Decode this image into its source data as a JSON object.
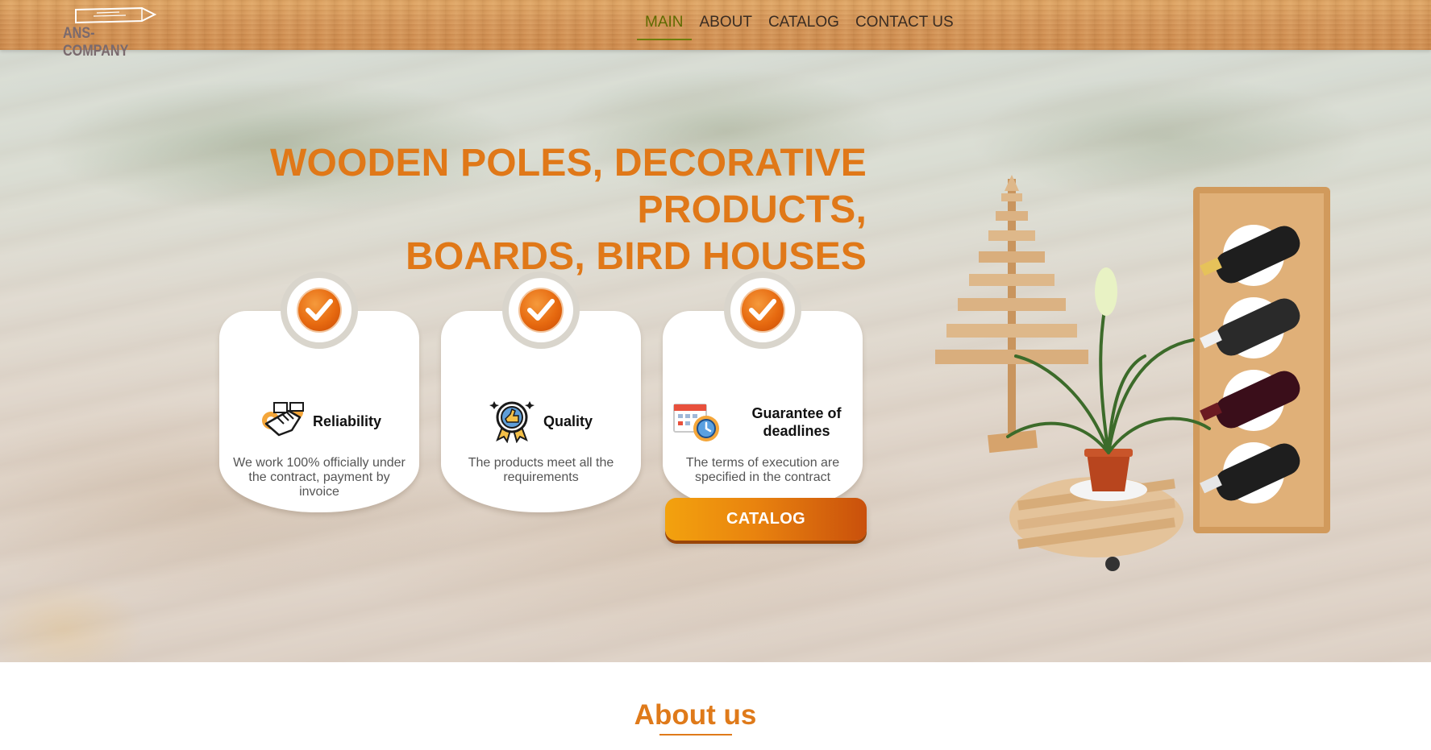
{
  "brand": {
    "name": "ANS-COMPANY"
  },
  "nav": {
    "items": [
      {
        "label": "MAIN",
        "active": true
      },
      {
        "label": "ABOUT",
        "active": false
      },
      {
        "label": "CATALOG",
        "active": false
      },
      {
        "label": "CONTACT US",
        "active": false
      }
    ]
  },
  "hero": {
    "title_line1": "WOODEN POLES, DECORATIVE PRODUCTS,",
    "title_line2": "BOARDS, BIRD HOUSES",
    "cards": [
      {
        "icon": "handshake-gears-icon",
        "title": "Reliability",
        "text": "We work 100% officially under the contract, payment by invoice"
      },
      {
        "icon": "quality-medal-icon",
        "title": "Quality",
        "text": "The products meet all the requirements"
      },
      {
        "icon": "calendar-clock-icon",
        "title": "Guarantee of deadlines",
        "text": "The terms of execution are specified in the contract"
      }
    ],
    "cta_label": "CATALOG"
  },
  "about": {
    "title": "About us"
  },
  "colors": {
    "accent": "#e07818",
    "nav_active": "#5e6a00",
    "button_start": "#f3a20e",
    "button_end": "#c9500c"
  }
}
